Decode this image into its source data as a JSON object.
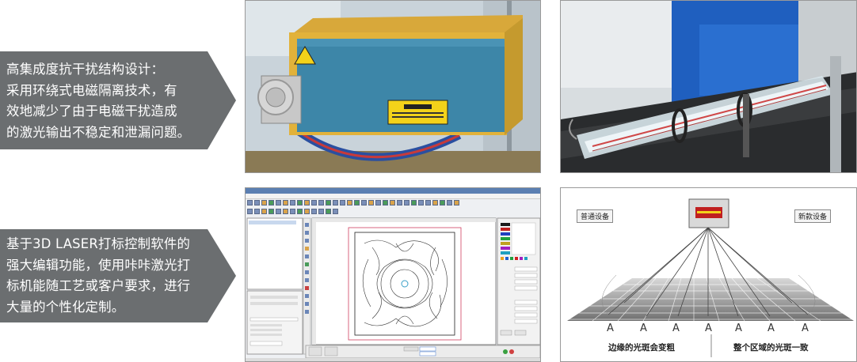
{
  "feature1": {
    "lines": [
      "高集成度抗干扰结构设计：",
      "采用环绕式电磁隔离技术，有",
      "效地减少了由于电磁干扰造成",
      "的激光输出不稳定和泄漏问题。"
    ]
  },
  "feature2": {
    "lines": [
      "基于3D LASER打标控制软件的",
      "强大编辑功能，使用咔咔激光打",
      "标机能随工艺或客户要求，进行",
      "大量的个性化定制。"
    ]
  },
  "diagram": {
    "left_label": "普通设备",
    "right_label": "新款设备",
    "letters": [
      "A",
      "A",
      "A",
      "A",
      "A",
      "A",
      "A"
    ],
    "caption_left": "边缘的光斑会变粗",
    "caption_right": "整个区域的光斑一致"
  },
  "colors": {
    "arrow_bg": "#6b6e70",
    "laser_box": "#3d86a8",
    "box_frame": "#e2b23a"
  }
}
